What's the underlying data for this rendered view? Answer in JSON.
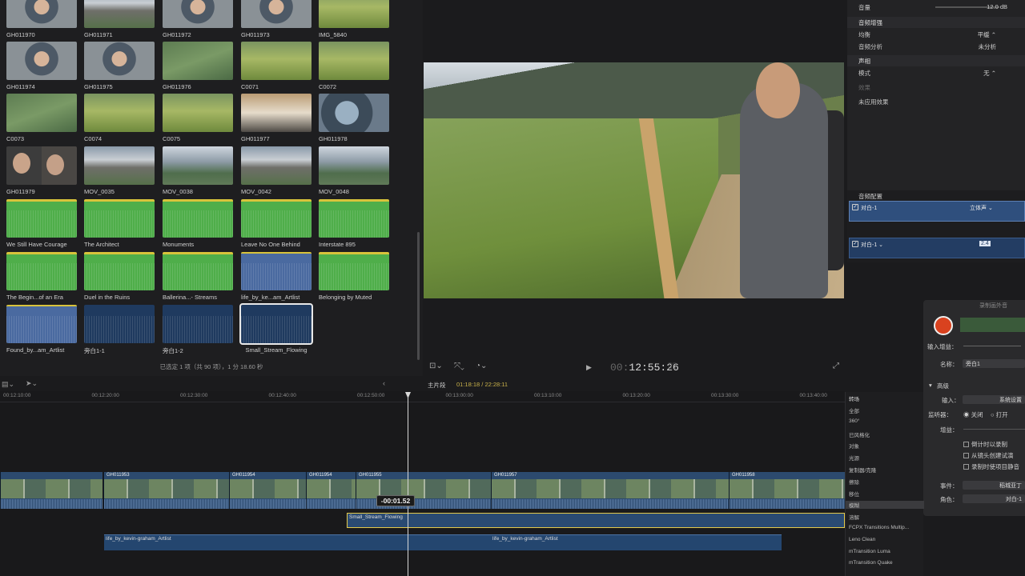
{
  "browser": {
    "clips": [
      {
        "label": "GH011970",
        "v": "v-person"
      },
      {
        "label": "GH011971",
        "v": "v-mountain"
      },
      {
        "label": "GH011972",
        "v": "v-person"
      },
      {
        "label": "GH011973",
        "v": "v-person"
      },
      {
        "label": "IMG_5840",
        "v": "v-meadow"
      },
      {
        "label": "GH011974",
        "v": "v-person"
      },
      {
        "label": "GH011975",
        "v": "v-person"
      },
      {
        "label": "GH011976",
        "v": "v-grass"
      },
      {
        "label": "C0071",
        "v": "v-meadow"
      },
      {
        "label": "C0072",
        "v": "v-meadow"
      },
      {
        "label": "C0073",
        "v": "v-grass"
      },
      {
        "label": "C0074",
        "v": "v-meadow"
      },
      {
        "label": "C0075",
        "v": "v-meadow"
      },
      {
        "label": "GH011977",
        "v": "v-cabin"
      },
      {
        "label": "GH011978",
        "v": "v-fish"
      },
      {
        "label": "GH011979",
        "v": "v-two"
      },
      {
        "label": "MOV_0035",
        "v": "v-mountain"
      },
      {
        "label": "MOV_0038",
        "v": "v-lake"
      },
      {
        "label": "MOV_0042",
        "v": "v-mountain"
      },
      {
        "label": "MOV_0048",
        "v": "v-lake"
      },
      {
        "label": "We Still Have Courage",
        "v": "v-audio-green"
      },
      {
        "label": "The Architect",
        "v": "v-audio-green"
      },
      {
        "label": "Monuments",
        "v": "v-audio-green"
      },
      {
        "label": "Leave No One Behind",
        "v": "v-audio-green"
      },
      {
        "label": "Interstate 895",
        "v": "v-audio-green"
      },
      {
        "label": "The Begin...of an Era",
        "v": "v-audio-green"
      },
      {
        "label": "Duel in the Ruins",
        "v": "v-audio-green"
      },
      {
        "label": "Ballerina...- Streams",
        "v": "v-audio-green"
      },
      {
        "label": "life_by_ke...am_Artlist",
        "v": "v-audio-blue"
      },
      {
        "label": "Belonging by Muted",
        "v": "v-audio-green"
      },
      {
        "label": "Found_by...am_Artlist",
        "v": "v-audio-blue"
      },
      {
        "label": "旁白1-1",
        "v": "v-audio-dark"
      },
      {
        "label": "旁白1-2",
        "v": "v-audio-dark"
      },
      {
        "label": "Small_Stream_Flowing",
        "v": "v-audio-dark"
      }
    ],
    "status": "已选定 1 项（共 90 项），1 分 18.60 秒"
  },
  "viewer": {
    "timecode_dim": "00:",
    "timecode": "12:55:26"
  },
  "inspector": {
    "volume_label": "音量",
    "volume_value": "12.0 dB",
    "enhance_head": "音频增强",
    "eq_label": "均衡",
    "eq_value": "平缓 ⌃",
    "analysis_label": "音频分析",
    "analysis_value": "未分析",
    "channel_head": "声相",
    "mode_label": "模式",
    "mode_value": "无 ⌃",
    "effect_head": "效果",
    "no_effect": "未应用效果",
    "audio_config": "音频配置",
    "track1": "对白-1",
    "track1_mode": "立体声 ⌄",
    "track2": "对白-1 ⌄",
    "track2_badge": "2.4"
  },
  "record": {
    "title": "录制画外音",
    "input_gain": "输入增益：",
    "name_label": "名称：",
    "name_value": "旁白1",
    "advanced": "高级",
    "input_label": "输入：",
    "input_value": "系统设置",
    "monitor_label": "监听器：",
    "monitor_off": "关闭",
    "monitor_on": "打开",
    "gain_label": "增益：",
    "opt1": "倒计时以录制",
    "opt2": "从镜头创建试演",
    "opt3": "录制时使项目静音",
    "event_label": "事件：",
    "event_value": "稻城亚丁",
    "role_label": "角色：",
    "role_value": "对白-1"
  },
  "timeline": {
    "toolbar_center": "主片段",
    "toolbar_time": "01:18:18 / 22:28:11",
    "ruler": [
      "00:00:12:10:00",
      "00:00:12:20:00",
      "00:00:12:30:00",
      "00:00:12:40:00",
      "00:00:12:50:00",
      "00:00:13:00:00",
      "00:00:13:10:00",
      "00:00:13:20:00",
      "00:00:13:30:00",
      "00:00:13:40:00"
    ],
    "ruler_display": [
      "00:12:10:00",
      "00:12:20:00",
      "00:12:30:00",
      "00:12:40:00",
      "00:12:50:00",
      "00:13:00:00",
      "00:13:10:00",
      "00:13:20:00",
      "00:13:30:00",
      "00:13:40:00"
    ],
    "video_clips": [
      "",
      "GH011953",
      "GH011954",
      "GH011954",
      "GH011955",
      "GH011957",
      "GH011958"
    ],
    "drag_clip": "Small_Stream_Flowing",
    "music1": "life_by_kevin-graham_Artlist",
    "music2": "life_by_kevin-graham_Artlist",
    "drag_offset": "-00:01.52"
  },
  "transitions": {
    "title": "转场",
    "items": [
      "全部",
      "360°",
      "已风格化",
      "对象",
      "光源",
      "复制器/克隆",
      "擦除",
      "移位",
      "模糊",
      "溶解",
      "FCPX Transitions Multip...",
      "Leno Clean",
      "mTransition Luma",
      "mTransition Quake"
    ],
    "selected": 8
  }
}
